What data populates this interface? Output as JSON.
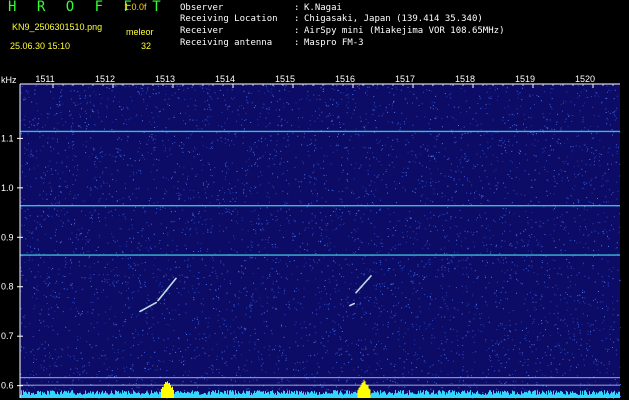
{
  "header": {
    "app_title": "H R O F F T",
    "version": "1.0.0f",
    "file_name": "KN9_2506301510.png",
    "mode": "meleor",
    "datetime": "25.06.30 15:10",
    "count": "32"
  },
  "info": [
    {
      "key": "Observer",
      "sep": ":",
      "value": "K.Nagai"
    },
    {
      "key": "Receiving Location",
      "sep": ":",
      "value": "Chigasaki, Japan (139.414 35.340)"
    },
    {
      "key": "Receiver",
      "sep": ":",
      "value": "AirSpy mini (Miakejima VOR 108.65MHz)"
    },
    {
      "key": "Receiving antenna",
      "sep": ":",
      "value": "Maspro FM-3"
    }
  ],
  "chart_data": {
    "type": "heatmap",
    "x_axis": {
      "tick_labels": [
        "1511",
        "1512",
        "1513",
        "1514",
        "1515",
        "1516",
        "1517",
        "1518",
        "1519",
        "1520"
      ],
      "label": ""
    },
    "y_axis": {
      "unit_label": "kHz",
      "tick_labels": [
        "1.1",
        "1.0",
        "0.9",
        "0.8",
        "0.7",
        "0.6"
      ],
      "tick_values": [
        1.1,
        1.0,
        0.9,
        0.8,
        0.7,
        0.6
      ],
      "range": [
        0.575,
        1.21
      ]
    },
    "x_range_minutes": [
      1510.45,
      1520.45
    ],
    "carrier_lines_khz": [
      1.114,
      0.964,
      0.864
    ],
    "reference_lines_khz": [
      0.616,
      0.601
    ],
    "meteor_echoes": [
      {
        "time": 1512.75,
        "time_end": 1513.05,
        "freq_start": 0.772,
        "freq_end": 0.817
      },
      {
        "time": 1512.45,
        "time_end": 1512.72,
        "freq_start": 0.75,
        "freq_end": 0.768
      },
      {
        "time": 1516.05,
        "time_end": 1516.3,
        "freq_start": 0.788,
        "freq_end": 0.822
      },
      {
        "time": 1515.95,
        "time_end": 1516.02,
        "freq_start": 0.762,
        "freq_end": 0.766
      }
    ],
    "colors": {
      "background": "#0c0c66",
      "noise": "#2a4cd0",
      "carrier": "#3ecfe0",
      "echo": "#e0ffff",
      "axis": "#ffffff",
      "activity_bar": "#33d6ff",
      "activity_peak": "#ffff00"
    }
  }
}
